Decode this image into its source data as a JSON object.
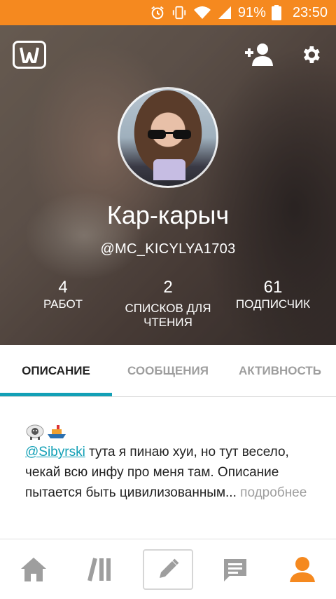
{
  "status_bar": {
    "battery_percent": "91%",
    "time": "23:50",
    "icons": [
      "alarm-icon",
      "vibrate-icon",
      "wifi-icon",
      "signal-icon",
      "battery-icon"
    ]
  },
  "profile": {
    "display_name": "Кар-карыч",
    "username": "@MC_KICYLYA1703",
    "stats": [
      {
        "value": "4",
        "label": "РАБОТ"
      },
      {
        "value": "2",
        "label": "СПИСКОВ ДЛЯ ЧТЕНИЯ"
      },
      {
        "value": "61",
        "label": "ПОДПИСЧИК"
      }
    ]
  },
  "tabs": [
    {
      "label": "ОПИСАНИЕ",
      "active": true
    },
    {
      "label": "СООБЩЕНИЯ",
      "active": false
    },
    {
      "label": "АКТИВНОСТЬ",
      "active": false
    }
  ],
  "description": {
    "mention": "@Sibyrski",
    "text": " тута я пинаю хуи, но тут весело, чекай всю инфу про меня там. Описание пытается быть цивилизованным...",
    "more_link": " подробнее"
  },
  "colors": {
    "status_bar": "#f5891f",
    "accent": "#12a0b6",
    "nav_active": "#f5891f",
    "nav_inactive": "#9e9e9e"
  },
  "bottom_nav": [
    "home-icon",
    "library-icon",
    "write-icon",
    "messages-icon",
    "profile-icon"
  ]
}
